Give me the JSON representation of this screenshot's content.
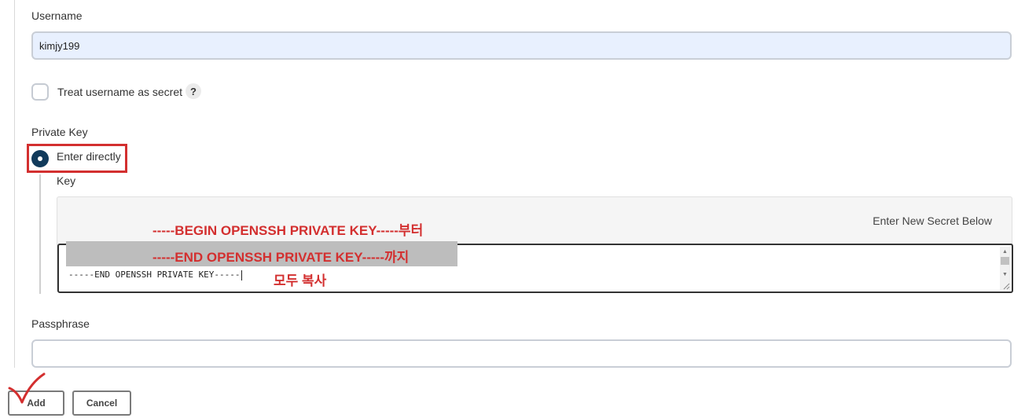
{
  "username": {
    "label": "Username",
    "value": "kimjy199"
  },
  "treat_secret": {
    "label": "Treat username as secret",
    "help_glyph": "?"
  },
  "private_key": {
    "label": "Private Key",
    "option_label": "Enter directly",
    "key_label": "Key",
    "secret_hint": "Enter New Secret Below",
    "key_text": "-----END OPENSSH PRIVATE KEY-----"
  },
  "annotations": {
    "line1": "-----BEGIN OPENSSH PRIVATE KEY-----부터",
    "line2": "-----END OPENSSH PRIVATE KEY-----까지",
    "line3": "모두 복사",
    "color": "#d32f2f"
  },
  "passphrase": {
    "label": "Passphrase",
    "value": ""
  },
  "buttons": {
    "add": "Add",
    "cancel": "Cancel"
  },
  "colors": {
    "radio_selected": "#113a5b",
    "filled_input_bg": "#e8f0fe"
  }
}
